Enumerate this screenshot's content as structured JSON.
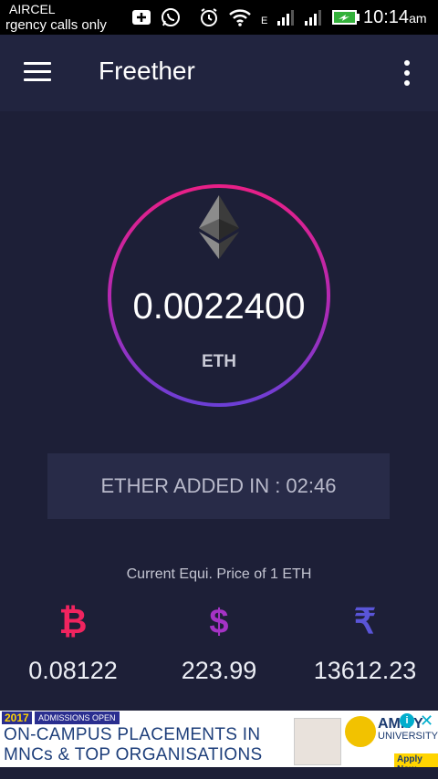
{
  "status_bar": {
    "carrier": "AIRCEL",
    "emergency": "rgency calls only",
    "time": "10:14",
    "ampm": "am",
    "signal_1_label": "1",
    "signal_2_label": "2",
    "network_type": "E"
  },
  "app_bar": {
    "title": "Freether"
  },
  "balance": {
    "amount": "0.0022400",
    "unit": "ETH"
  },
  "timer": {
    "text": "ETHER ADDED IN : 02:46"
  },
  "price": {
    "label": "Current Equi. Price of 1 ETH",
    "currencies": [
      {
        "symbol": "₿",
        "value": "0.08122",
        "color": "#f0245f"
      },
      {
        "symbol": "$",
        "value": "223.99",
        "color": "#a533c5"
      },
      {
        "symbol": "₹",
        "value": "13612.23",
        "color": "#5a55d8"
      }
    ]
  },
  "ad": {
    "year": "2017",
    "tag": "ADMISSIONS OPEN",
    "line1": "ON-CAMPUS PLACEMENTS IN",
    "line2": "MNCs & TOP ORGANISATIONS",
    "brand": "AMITY",
    "brand_sub": "UNIVERSITY",
    "apply": "Apply Now",
    "info": "i",
    "close": "✕"
  },
  "colors": {
    "background": "#1d1f37",
    "app_bar": "#21243f",
    "ring_top": "#e91f86",
    "ring_bottom": "#6b3fd6"
  }
}
